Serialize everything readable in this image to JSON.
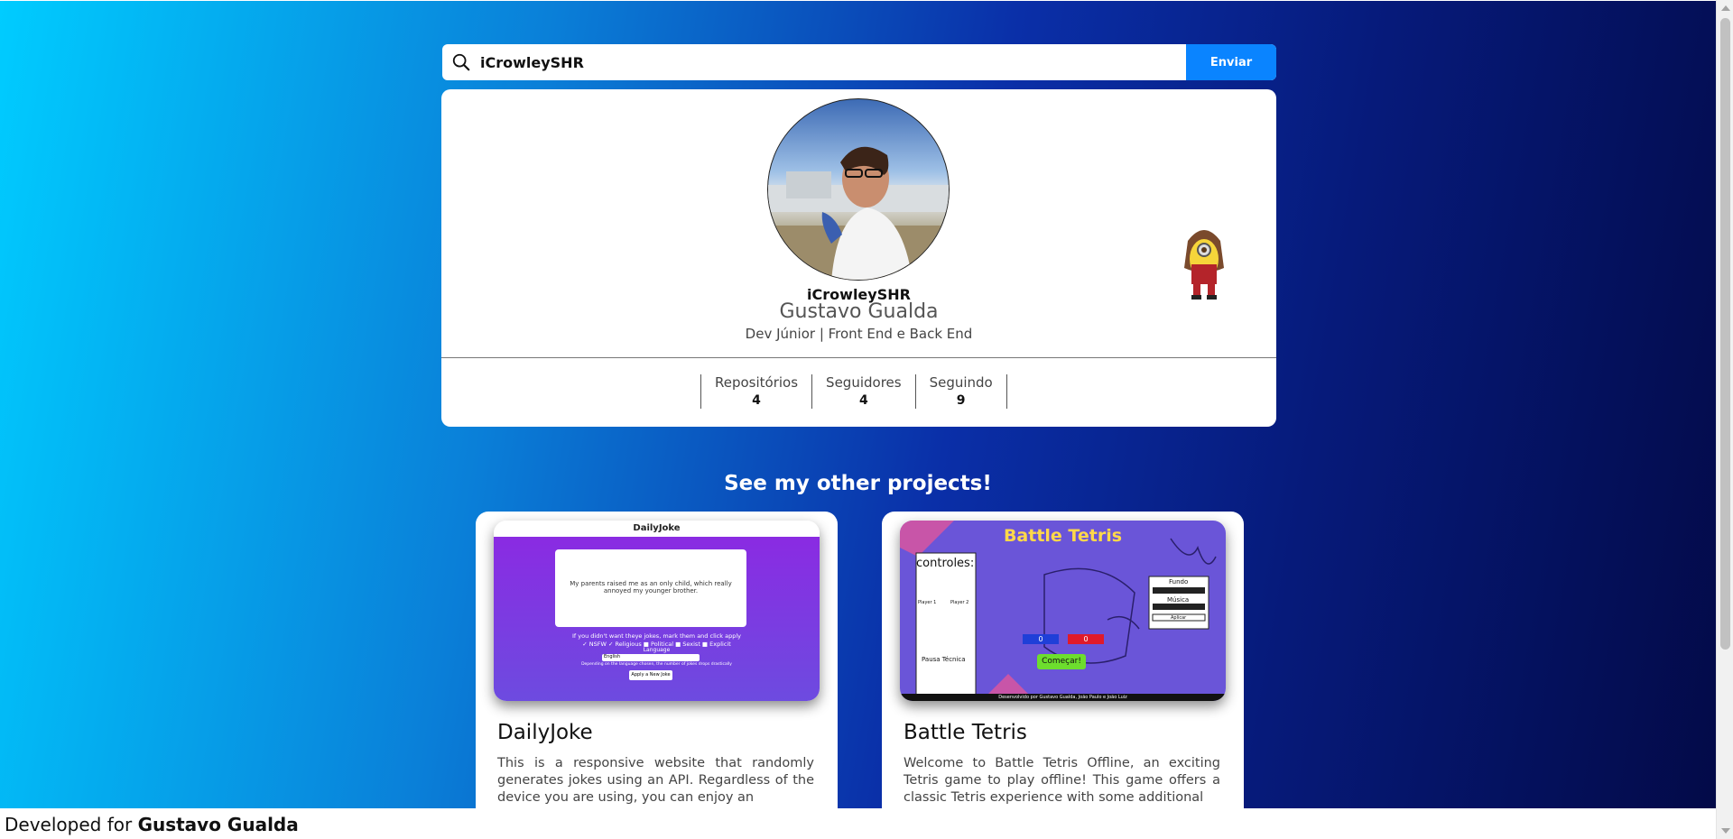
{
  "search": {
    "value": "iCrowleySHR",
    "button_label": "Enviar"
  },
  "profile": {
    "username": "iCrowleySHR",
    "name": "Gustavo Gualda",
    "bio": "Dev Júnior | Front End e Back End",
    "stats": [
      {
        "label": "Repositórios",
        "value": "4"
      },
      {
        "label": "Seguidores",
        "value": "4"
      },
      {
        "label": "Seguindo",
        "value": "9"
      }
    ]
  },
  "projects_title": "See my other projects!",
  "projects": [
    {
      "name": "DailyJoke",
      "description": "This is a responsive website that randomly generates jokes using an API. Regardless of the device you are using, you can enjoy an",
      "screenshot": {
        "header": "DailyJoke",
        "joke": "My parents raised me as an only child, which really annoyed my younger brother.",
        "hint": "If you didn't want theye jokes, mark them and click apply",
        "filters": "✓ NSFW ✓ Religious ■ Political ■ Sexist ■ Explicit",
        "language_label": "Language",
        "language_value": "English",
        "note": "Depending on the language chosen, the number of jokes drops drastically",
        "button": "Apply a New Joke"
      }
    },
    {
      "name": "Battle Tetris",
      "description": "Welcome to Battle Tetris Offline, an exciting Tetris game to play offline! This game offers a classic Tetris experience with some additional",
      "screenshot": {
        "title": "Battle Tetris",
        "controls_title": "controles:",
        "player1": "Player 1",
        "player2": "Player 2",
        "pause_label": "Pausa Técnica",
        "score1": "0",
        "score2": "0",
        "start_button": "Começar!",
        "panel_fundo": "Fundo",
        "panel_musica": "Música",
        "panel_apply": "Aplicar",
        "footer": "Desenvolvido por Gustavo Gualda, João Paulo e João Luiz"
      }
    }
  ],
  "footer": {
    "prefix": "Developed for",
    "name": "Gustavo Gualda"
  },
  "colors": {
    "accent": "#0a84ff",
    "gradient_start": "#00ccff",
    "gradient_end": "#030a48"
  }
}
